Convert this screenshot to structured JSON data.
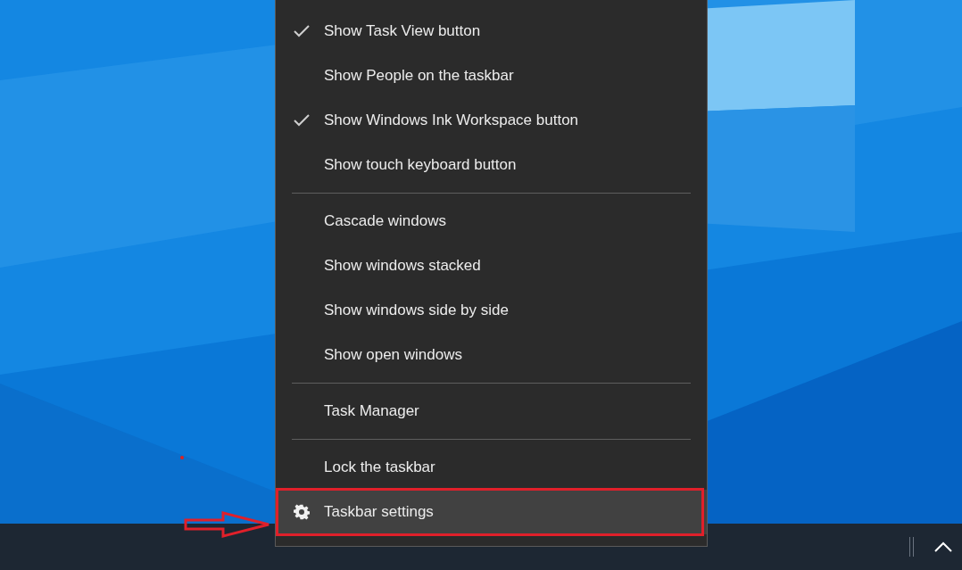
{
  "context_menu": {
    "groups": [
      {
        "items": [
          {
            "label": "Show Task View button",
            "checked": true,
            "selected": false
          },
          {
            "label": "Show People on the taskbar",
            "checked": false,
            "selected": false
          },
          {
            "label": "Show Windows Ink Workspace button",
            "checked": true,
            "selected": false
          },
          {
            "label": "Show touch keyboard button",
            "checked": false,
            "selected": false
          }
        ]
      },
      {
        "items": [
          {
            "label": "Cascade windows",
            "selected": false
          },
          {
            "label": "Show windows stacked",
            "selected": false
          },
          {
            "label": "Show windows side by side",
            "selected": false
          },
          {
            "label": "Show open windows",
            "selected": false
          }
        ]
      },
      {
        "items": [
          {
            "label": "Task Manager",
            "selected": false
          }
        ]
      },
      {
        "items": [
          {
            "label": "Lock the taskbar",
            "selected": false
          },
          {
            "label": "Taskbar settings",
            "kind": "settings",
            "selected": true
          }
        ]
      }
    ]
  }
}
